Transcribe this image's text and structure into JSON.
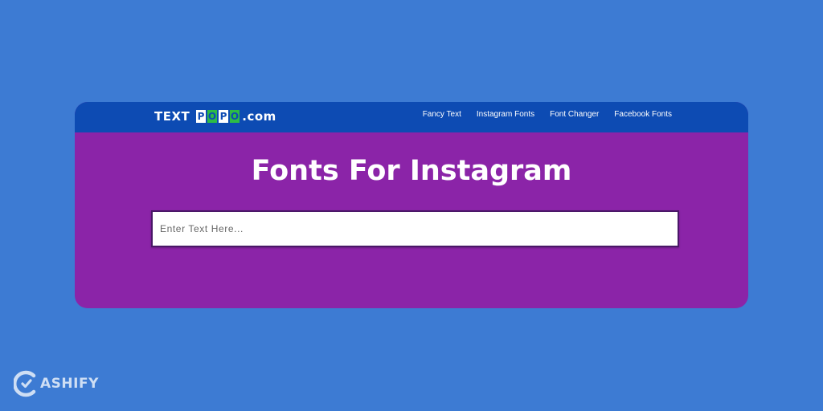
{
  "logo": {
    "word": "TEXT",
    "tiles": [
      "P",
      "O",
      "P",
      "O"
    ],
    "domain": ".com"
  },
  "nav": {
    "items": [
      {
        "label": "Fancy Text"
      },
      {
        "label": "Instagram Fonts"
      },
      {
        "label": "Font Changer"
      },
      {
        "label": "Facebook Fonts"
      }
    ]
  },
  "main": {
    "title": "Fonts For Instagram",
    "input": {
      "placeholder": "Enter Text Here...",
      "value": ""
    }
  },
  "watermark": {
    "text": "ASHIFY",
    "icon": "cashify-logo-icon"
  },
  "colors": {
    "background": "#3d7bd3",
    "navbar": "#0d4bb3",
    "card": "#8b24a8",
    "logo_tile_accent": "#2dbb46"
  }
}
